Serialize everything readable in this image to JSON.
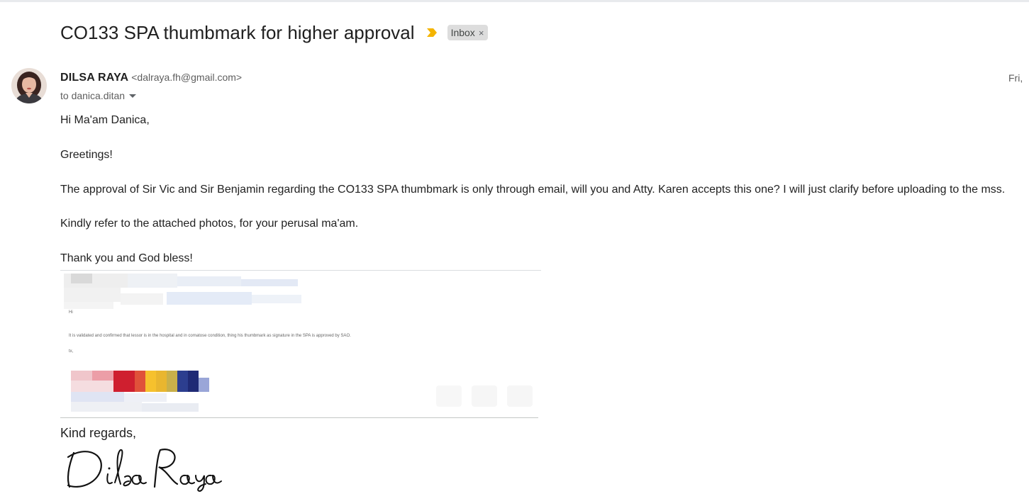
{
  "email": {
    "subject": "CO133 SPA thumbmark for higher approval",
    "label_chip": "Inbox",
    "label_chip_close": "×",
    "sender_name": "DILSA RAYA",
    "sender_email": "<dalraya.fh@gmail.com>",
    "date": "Fri, ",
    "recipient": "to danica.ditan",
    "importance_color": "#f4b400"
  },
  "body": {
    "greeting": "Hi Ma'am Danica,",
    "line1": "Greetings!",
    "line2": "The approval of Sir Vic and Sir Benjamin regarding the CO133 SPA thumbmark is only through email, will you and Atty. Karen accepts this one? I will just clarify before uploading to the mss.",
    "line3": "Kindly refer to the attached photos, for your perusal ma'am.",
    "line4": "Thank you and God bless!"
  },
  "attached_image": {
    "greeting": "Hi",
    "statement": "It is validated and confirmed that lessor is in the hospital and in comatose condition, thing his thumbmark as signature in the SPA is approved by SAO.",
    "closing": "tx,"
  },
  "closing": {
    "regards": "Kind regards,",
    "signature": "Dilsa Raya"
  }
}
